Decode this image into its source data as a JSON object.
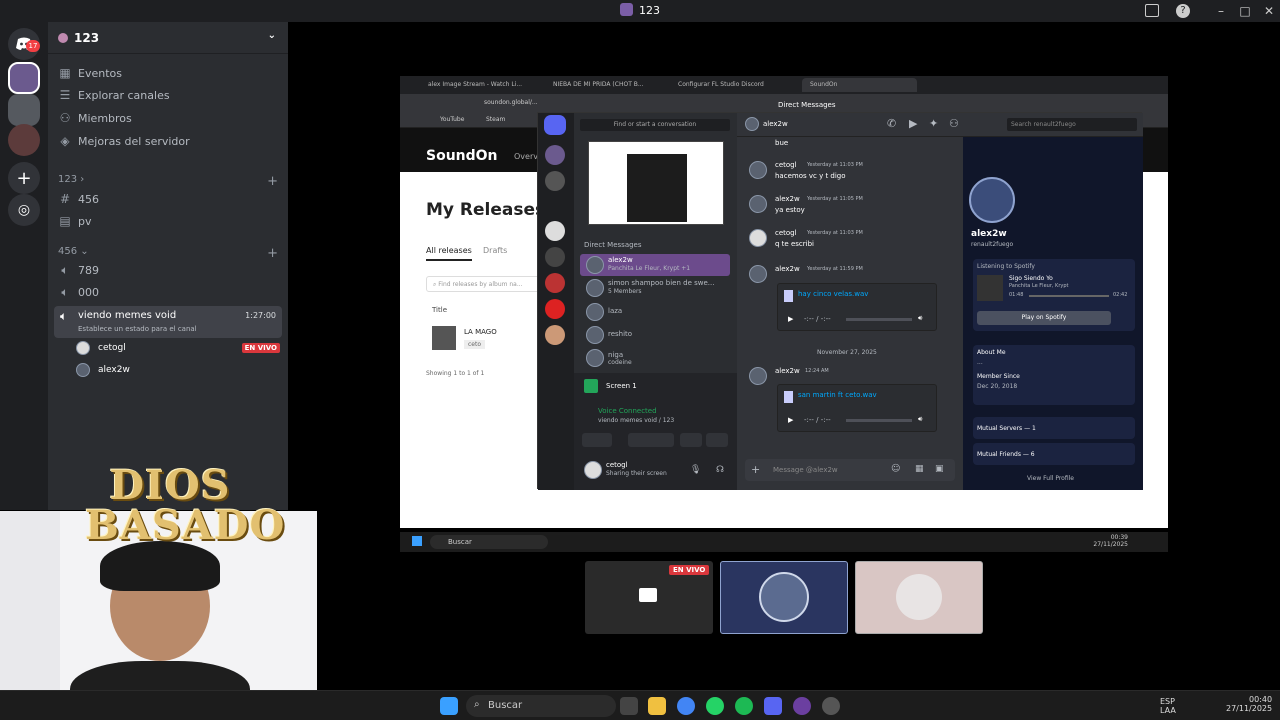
{
  "window": {
    "title": "123"
  },
  "server": {
    "name": "123"
  },
  "sidebar": {
    "top_items": [
      {
        "label": "Eventos",
        "icon": "calendar-icon"
      },
      {
        "label": "Explorar canales",
        "icon": "compass-icon"
      },
      {
        "label": "Miembros",
        "icon": "members-icon"
      },
      {
        "label": "Mejoras del servidor",
        "icon": "boost-icon"
      }
    ],
    "categories": [
      {
        "label": "123",
        "channels": [
          {
            "label": "456",
            "icon": "hash-icon"
          },
          {
            "label": "pv",
            "icon": "text-channel-icon"
          }
        ]
      },
      {
        "label": "456",
        "channels": [
          {
            "label": "789",
            "icon": "voice-icon"
          },
          {
            "label": "000",
            "icon": "voice-icon"
          },
          {
            "label": "viendo memes void",
            "icon": "voice-icon",
            "time": "1:27:00",
            "status": "Establece un estado para el canal"
          }
        ]
      }
    ],
    "voice_users": [
      {
        "name": "cetogl",
        "badge": "EN VIVO"
      },
      {
        "name": "alex2w",
        "badge": ""
      }
    ],
    "rail_badge": "17"
  },
  "overlay": {
    "text_line1": "DIOS",
    "text_line2": "BASADO"
  },
  "browser": {
    "tabs": [
      "alex Image Stream - Watch Li...",
      "NIEBA DE MI PRIDA (CHOT B...",
      "Configurar FL Studio Discord",
      "SoundOn"
    ],
    "address": "soundon.global/...",
    "bookmarks": [
      "YouTube",
      "Steam"
    ],
    "brand": "SoundOn",
    "nav_item": "Overvi",
    "page_title": "My Releases",
    "filter_tabs": [
      "All releases",
      "Drafts"
    ],
    "search_placeholder": "Find releases by album na...",
    "column_title": "Title",
    "release": {
      "title": "LA MAGO",
      "artist": "ceto"
    },
    "footer": "Showing 1 to 1 of 1"
  },
  "discord_inner": {
    "search": "Find or start a conversation",
    "dm_header": "Direct Messages",
    "dm_user": "alex2w",
    "top_search": "Search renault2fuego",
    "dm_list": [
      {
        "name": "alex2w",
        "sub": "Panchita Le Fleur, Krypt +1"
      },
      {
        "name": "simon shampoo bien de swe...",
        "sub": "5 Members"
      },
      {
        "name": "laza",
        "sub": ""
      },
      {
        "name": "reshito",
        "sub": ""
      },
      {
        "name": "niga",
        "sub": "codeine"
      }
    ],
    "screen_label": "Screen 1",
    "voice_status": "Voice Connected",
    "voice_channel": "viendo memes void / 123",
    "self_name": "cetogl",
    "self_sub": "Sharing their screen",
    "messages": [
      {
        "author": "",
        "time": "",
        "text": "bue"
      },
      {
        "author": "cetogl",
        "time": "Yesterday at 11:03 PM",
        "text": "hacemos vc y t digo"
      },
      {
        "author": "alex2w",
        "time": "Yesterday at 11:05 PM",
        "text": "ya estoy"
      },
      {
        "author": "cetogl",
        "time": "Yesterday at 11:03 PM",
        "text": "q te escribi"
      },
      {
        "author": "alex2w",
        "time": "Yesterday at 11:59 PM",
        "text": ""
      }
    ],
    "file1": "hay cinco velas.wav",
    "audio_time": "-:-- / -:--",
    "date_divider": "November 27, 2025",
    "msg_last": {
      "author": "alex2w",
      "time": "12:24 AM",
      "file": "san martin ft ceto.wav"
    },
    "composer": "Message @alex2w",
    "profile": {
      "name": "alex2w",
      "tag": "renault2fuego",
      "listening": "Listening to Spotify",
      "song": "Sigo Siendo Yo",
      "artist": "Panchita Le Fleur, Krypt",
      "t_start": "01:48",
      "t_end": "02:42",
      "play_btn": "Play on Spotify",
      "about_label": "About Me",
      "about_text": "...",
      "since_label": "Member Since",
      "since": "Dec 20, 2018",
      "mutual_servers": "Mutual Servers — 1",
      "mutual_friends": "Mutual Friends — 6",
      "view_full": "View Full Profile"
    }
  },
  "inner_taskbar": {
    "search": "Buscar",
    "lang": "ESP\nLAA",
    "time": "00:39",
    "date": "27/11/2025"
  },
  "stream_tiles": {
    "live_badge": "EN VIVO"
  },
  "taskbar": {
    "search": "Buscar",
    "lang": "ESP\nLAA",
    "time": "00:40",
    "date": "27/11/2025"
  }
}
